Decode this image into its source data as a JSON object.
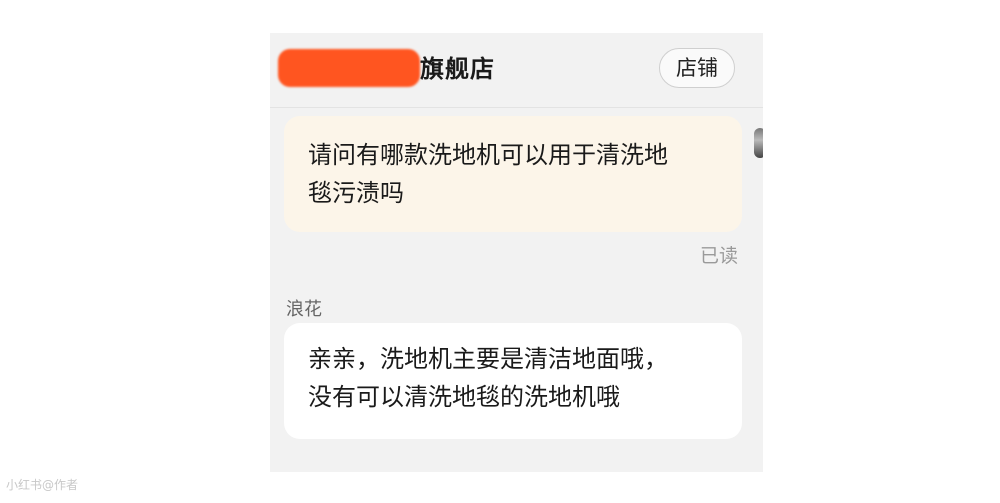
{
  "header": {
    "shop_name_visible": "旗舰店",
    "store_button_label": "店铺"
  },
  "messages": [
    {
      "direction": "outgoing",
      "lines": [
        "请问有哪款洗地机可以用于清洗地",
        "毯污渍吗"
      ],
      "status": "已读"
    },
    {
      "direction": "incoming",
      "sender": "浪花",
      "lines": [
        "亲亲，洗地机主要是清洁地面哦，",
        "没有可以清洗地毯的洗地机哦"
      ]
    }
  ],
  "watermark": "小红书@作者",
  "colors": {
    "page_background": "#ffffff",
    "chat_background": "#f2f2f2",
    "outgoing_bubble": "#fcf5e9",
    "incoming_bubble": "#ffffff",
    "redaction": "#ff5520",
    "muted_text": "#9a9a9a"
  }
}
